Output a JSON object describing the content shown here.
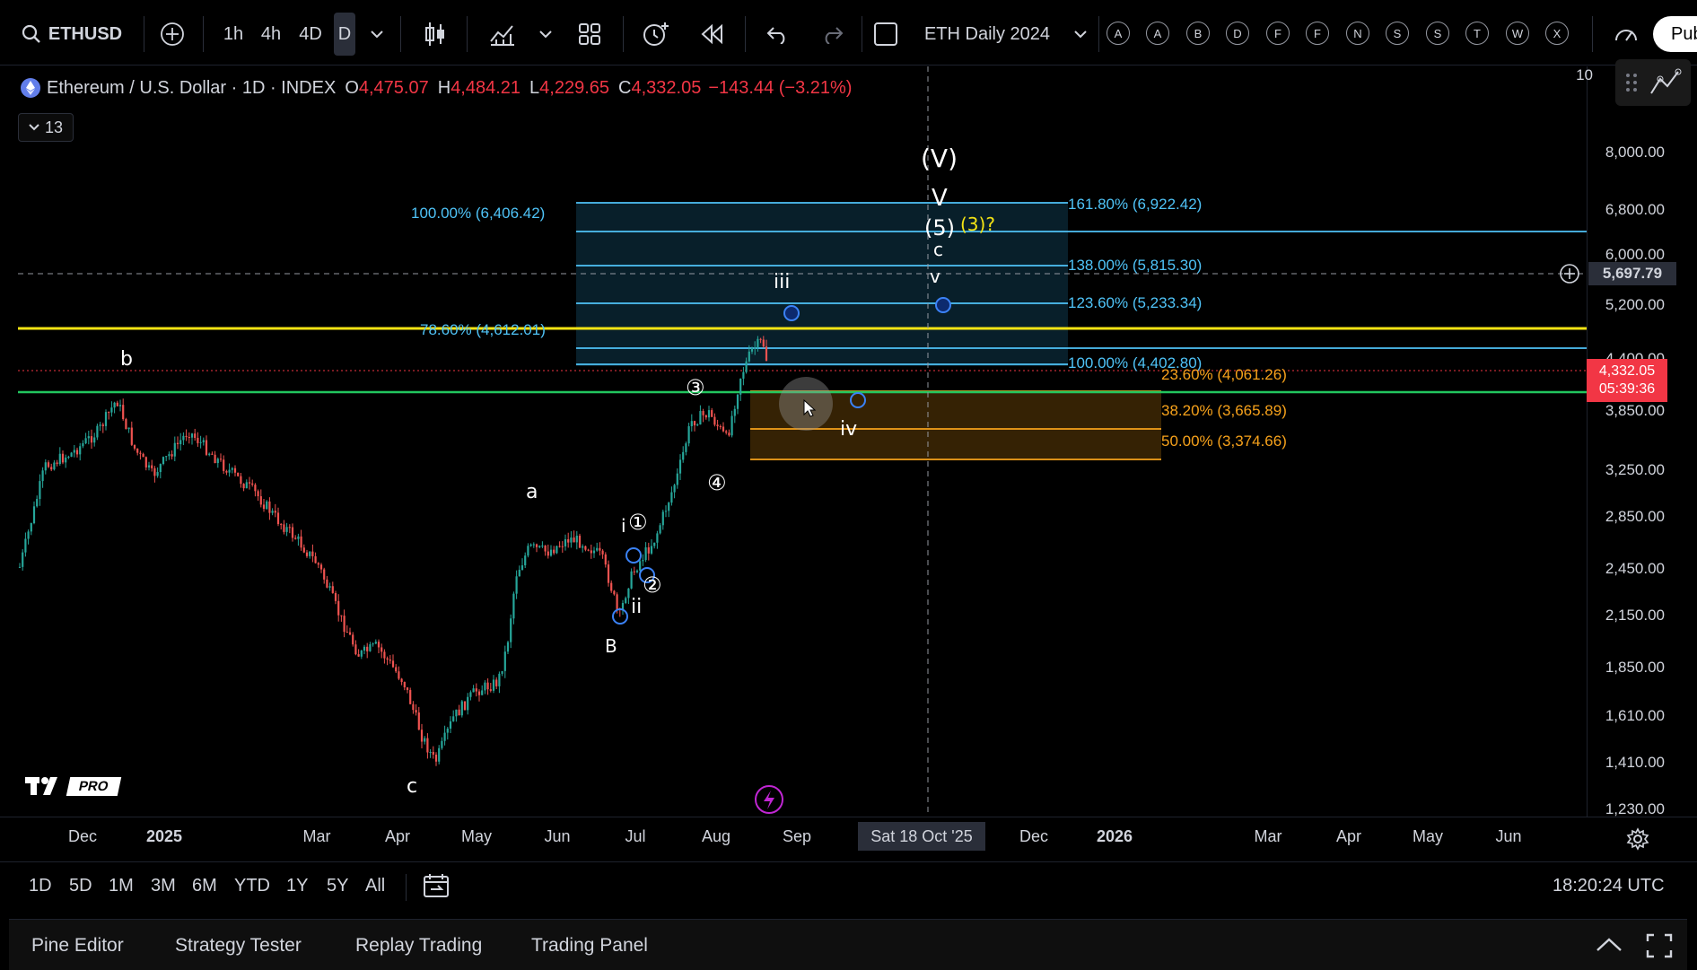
{
  "toolbar": {
    "symbol": "ETHUSD",
    "intervals": [
      "1h",
      "4h",
      "4D",
      "D"
    ],
    "active_interval": "D",
    "layout_name": "ETH Daily 2024",
    "alert_letters": [
      "A",
      "A",
      "B",
      "D",
      "F",
      "F",
      "N",
      "S",
      "S",
      "T",
      "W",
      "X"
    ],
    "publish_label": "Pub"
  },
  "legend": {
    "title": "Ethereum / U.S. Dollar · 1D · INDEX",
    "open_key": "O",
    "open": "4,475.07",
    "high_key": "H",
    "high": "4,484.21",
    "low_key": "L",
    "low": "4,229.65",
    "close_key": "C",
    "close": "4,332.05",
    "change": "−143.44 (−3.21%)",
    "collapsed_count": "13"
  },
  "price_axis": {
    "top_label": "10",
    "labels": [
      "8,000.00",
      "6,800.00",
      "6,000.00",
      "5,200.00",
      "4,400.00",
      "3,850.00",
      "3,250.00",
      "2,850.00",
      "2,450.00",
      "2,150.00",
      "1,850.00",
      "1,610.00",
      "1,410.00",
      "1,230.00"
    ],
    "crosshair_price": "5,697.79",
    "last_price": "4,332.05",
    "countdown": "05:39:36",
    "last_price_color": "#f23645"
  },
  "time_axis": {
    "labels": [
      "Dec",
      "2025",
      "Mar",
      "Apr",
      "May",
      "Jun",
      "Jul",
      "Aug",
      "Sep",
      "Dec",
      "2026",
      "Mar",
      "Apr",
      "May",
      "Jun"
    ],
    "crosshair_date": "Sat 18 Oct '25"
  },
  "fib_extension": {
    "labels": [
      "100.00% (6,406.42)",
      "78.60% (4,612.01)",
      "161.80% (6,922.42)",
      "138.00% (5,815.30)",
      "123.60% (5,233.34)",
      "100.00% (4,402.80)"
    ],
    "color": "#4fc3f7"
  },
  "fib_retracement": {
    "labels": [
      "23.60% (4,061.26)",
      "38.20% (3,665.89)",
      "50.00% (3,374.66)"
    ],
    "color": "#f7a21b"
  },
  "wave_labels": {
    "big_v": "(V)",
    "v_upper": "V",
    "five": "(5)",
    "three_q": "(3)?",
    "c_upper": "c",
    "v_lower": "v",
    "iii": "iii",
    "iv": "iv",
    "b_left": "b",
    "a_mid": "a",
    "c_low": "c",
    "i": "i",
    "ii": "ii",
    "b_circled": "B",
    "n1": "①",
    "n2": "②",
    "n3": "③",
    "n4": "④"
  },
  "logo_text": "PRO",
  "range_bar": {
    "ranges": [
      "1D",
      "5D",
      "1M",
      "3M",
      "6M",
      "YTD",
      "1Y",
      "5Y",
      "All"
    ],
    "clock": "18:20:24 UTC"
  },
  "panel_bar": {
    "tabs": [
      "Pine Editor",
      "Strategy Tester",
      "Replay Trading",
      "Trading Panel"
    ]
  },
  "colors": {
    "up": "#26a69a",
    "down": "#ef5350",
    "yellow_line": "#f5e414",
    "green_line": "#22c55e",
    "fib_blue": "#4fc3f7",
    "fib_orange": "#f7a21b"
  }
}
